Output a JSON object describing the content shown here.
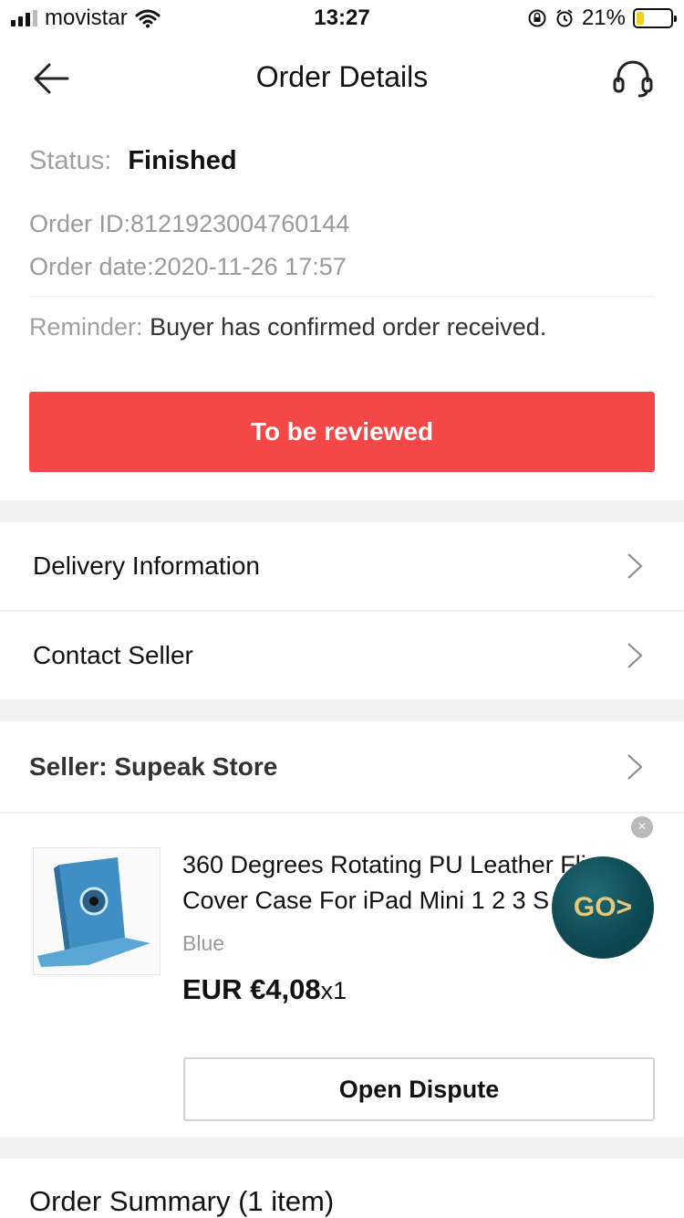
{
  "status_bar": {
    "carrier": "movistar",
    "time": "13:27",
    "battery_percent": "21%",
    "battery_level": 0.21,
    "icons": [
      "signal-icon",
      "wifi-icon",
      "rotation-lock-icon",
      "alarm-icon",
      "battery-icon"
    ]
  },
  "header": {
    "title": "Order Details",
    "back_icon": "back-arrow-icon",
    "support_icon": "headset-icon"
  },
  "order": {
    "status_label": "Status:",
    "status_value": "Finished",
    "order_id_text": "Order ID:8121923004760144",
    "order_date_text": "Order date:2020-11-26 17:57",
    "reminder_label": "Reminder:",
    "reminder_value": "Buyer has confirmed order received."
  },
  "actions": {
    "review_label": "To be reviewed",
    "review_color": "#f44848"
  },
  "rows": {
    "delivery_label": "Delivery Information",
    "contact_label": "Contact Seller",
    "seller_label": "Seller: Supeak Store"
  },
  "product": {
    "title": "360 Degrees Rotating PU Leather Flip Cover Case For iPad Mini 1 2 3 S",
    "variant": "Blue",
    "price": "EUR €4,08",
    "quantity": "x1",
    "image_color": "#3f8fc4"
  },
  "floating": {
    "go_label": "GO>",
    "close_glyph": "×"
  },
  "dispute": {
    "label": "Open Dispute"
  },
  "summary": {
    "title": "Order Summary (1 item)"
  }
}
